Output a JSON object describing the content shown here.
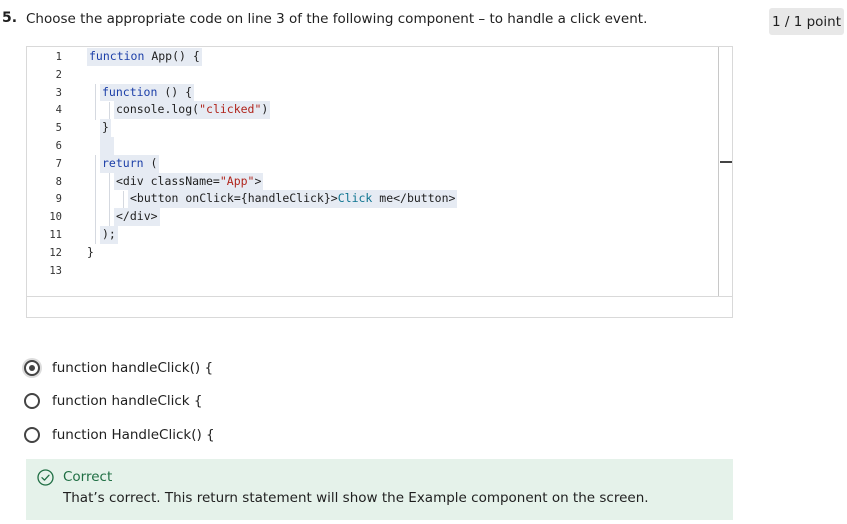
{
  "question": {
    "number": "5.",
    "text": "Choose the appropriate code on line 3 of the following component – to handle a click event.",
    "points": "1 / 1 point"
  },
  "code": {
    "line_numbers": [
      "1",
      "2",
      "3",
      "4",
      "5",
      "6",
      "7",
      "8",
      "9",
      "10",
      "11",
      "12",
      "13"
    ],
    "lines": {
      "l1": {
        "kw": "function",
        "rest": " App() {"
      },
      "l3": {
        "kw": "function",
        "rest": " () {"
      },
      "l4": {
        "a": "console.log(",
        "s": "\"clicked\"",
        "b": ")"
      },
      "l5": "}",
      "l7": {
        "kw": "return",
        "rest": " ("
      },
      "l8": {
        "a": "<div className=",
        "s": "\"App\"",
        "b": ">"
      },
      "l9": {
        "a": "<button onClick={handleClick}>",
        "t": "Click",
        "b": " me</button>"
      },
      "l10": "</div>",
      "l11": ");",
      "l12": "}"
    }
  },
  "options": [
    {
      "label": "function handleClick() {",
      "selected": true
    },
    {
      "label": "function handleClick {",
      "selected": false
    },
    {
      "label": "function HandleClick() {",
      "selected": false
    }
  ],
  "feedback": {
    "title": "Correct",
    "body": "That’s correct. This return statement will show the Example component on the screen.",
    "icon": "check-circle-icon",
    "color": "#1f6e43",
    "background": "#e5f2ea"
  }
}
